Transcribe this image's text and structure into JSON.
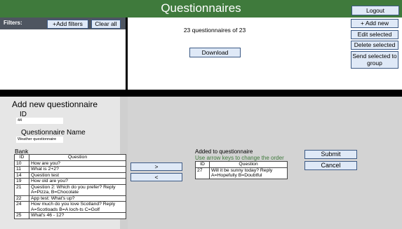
{
  "header": {
    "title": "Questionnaires",
    "logout_label": "Logout"
  },
  "filters": {
    "label": "Filters:",
    "add_filters_label": "+Add filters",
    "clear_all_label": "Clear all"
  },
  "info": {
    "count_text": "23 questionnaires of 23",
    "download_label": "Download"
  },
  "actions": {
    "add_new_label": "+ Add new",
    "edit_selected_label": "Edit selected",
    "delete_selected_label": "Delete selected",
    "send_selected_label": "Send selected to group"
  },
  "form": {
    "title": "Add new questionnaire",
    "id_label": "ID",
    "id_value": "44",
    "name_label": "Questionnaire Name",
    "name_value": "Weather questionnaire",
    "bank_label": "Bank",
    "table_headers": [
      "ID",
      "Question"
    ],
    "bank_rows": [
      {
        "id": "10",
        "question": "How are you?"
      },
      {
        "id": "11",
        "question": "What is 2+2?"
      },
      {
        "id": "14",
        "question": "Question test"
      },
      {
        "id": "19",
        "question": "How old are you?"
      },
      {
        "id": "21",
        "question": "Question 2: Which do you prefer? Reply A=Pizza, B=Chocolate"
      },
      {
        "id": "22",
        "question": "App test: What's up?"
      },
      {
        "id": "24",
        "question": "How much do you love Scotland? Reply A=Scotloads B=A loch-ts C=Golf"
      },
      {
        "id": "25",
        "question": "What's 46 - 12?"
      }
    ]
  },
  "transfer": {
    "right_label": ">",
    "left_label": "<"
  },
  "added": {
    "title": "Added to questionnaire",
    "hint": "Use arrow keys to change the order",
    "table_headers": [
      "ID",
      "Question"
    ],
    "rows": [
      {
        "id": "27",
        "question": "Will it be sunny today? Reply A=Hopefully B=Doubtful"
      }
    ]
  },
  "submit_label": "Submit",
  "cancel_label": "Cancel",
  "colors": {
    "header_green": "#3f7a3c",
    "button_fill": "#dfe9f7",
    "button_border": "#3d5a85"
  }
}
